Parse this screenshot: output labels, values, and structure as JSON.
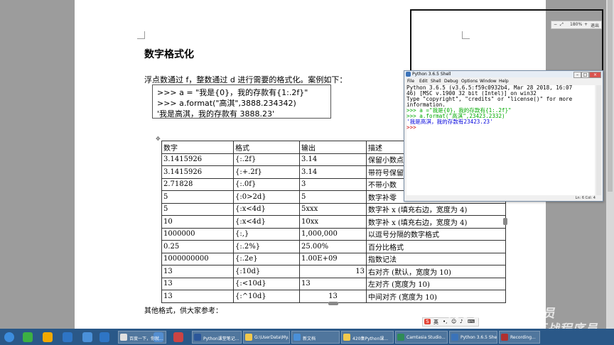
{
  "document": {
    "title": "数字格式化",
    "intro": "浮点数通过 f，整数通过 d 进行需要的格式化。案例如下：",
    "code_lines": [
      ">>> a = \"我是{0}，我的存款有{1:.2f}\"",
      ">>> a.format(\"高淇\",3888.234342)",
      "'我是高淇，我的存款有 3888.23'"
    ],
    "table": {
      "headers": [
        "数字",
        "格式",
        "输出",
        "描述"
      ],
      "rows": [
        [
          "3.1415926",
          "{:.2f}",
          "3.14",
          "保留小数点"
        ],
        [
          "3.1415926",
          "{:+.2f}",
          "3.14",
          "带符号保留"
        ],
        [
          "2.71828",
          "{:.0f}",
          "3",
          "不带小数"
        ],
        [
          "5",
          "{:0>2d}",
          "5",
          "数字补零"
        ],
        [
          "5",
          "{:x<4d}",
          "5xxx",
          "数字补 x (填充右边，宽度为 4)"
        ],
        [
          "10",
          "{:x<4d}",
          "10xx",
          "数字补 x (填充右边，宽度为 4)"
        ],
        [
          "1000000",
          "{:,}",
          "1,000,000",
          "以逗号分隔的数字格式"
        ],
        [
          "0.25",
          "{:.2%}",
          "25.00%",
          "百分比格式"
        ],
        [
          "1000000000",
          "{:.2e}",
          "1.00E+09",
          "指数记法"
        ],
        [
          "13",
          "{:10d}",
          "13",
          "右对齐 (默认，宽度为 10)"
        ],
        [
          "13",
          "{:<10d}",
          "13",
          "左对齐 (宽度为 10)"
        ],
        [
          "13",
          "{:^10d}",
          "13",
          "中间对齐 (宽度为 10)"
        ]
      ],
      "output_align": [
        "left",
        "left",
        "left",
        "left",
        "left",
        "left",
        "left",
        "left",
        "left",
        "right",
        "left",
        "center"
      ]
    },
    "footer": "其他格式，供大家参考："
  },
  "zoom": {
    "level": "180%",
    "exit_label": "退出"
  },
  "shell": {
    "title": "Python 3.6.5 Shell",
    "menu": [
      "File",
      "Edit",
      "Shell",
      "Debug",
      "Options",
      "Window",
      "Help"
    ],
    "lines": [
      {
        "text": "Python 3.6.5 (v3.6.5:f59c0932b4, Mar 28 2018, 16:07",
        "color": "#000000"
      },
      {
        "text": "46) [MSC v.1900 32 bit (Intel)] on win32",
        "color": "#000000"
      },
      {
        "text": "Type \"copyright\", \"credits\" or \"license()\" for more",
        "color": "#000000"
      },
      {
        "text": " information.",
        "color": "#000000"
      },
      {
        "text": ">>> a =\"我是{0}，我的存款有{1:.2f}\"",
        "color": "#00aa00"
      },
      {
        "text": ">>> a.format(\"高淇\",23423.2332)",
        "color": "#00aa00"
      },
      {
        "text": "'我是高淇，我的存款有23423.23'",
        "color": "#0000dd"
      },
      {
        "text": ">>> ",
        "color": "#cc0000"
      }
    ],
    "status": "Ln: 6  Col: 4"
  },
  "watermark": [
    "尚学堂·百战程序员",
    "尚学堂·百战程序员"
  ],
  "ime": {
    "label": "英"
  },
  "taskbar": {
    "buttons": [
      {
        "label": "百度一下，你就...",
        "color": "#e0e0e0"
      },
      {
        "label": "Python课堂笔记...",
        "color": "#2b579a"
      },
      {
        "label": "G:\\UserData\\My...",
        "color": "#f2c94c"
      },
      {
        "label": "新文档",
        "color": "#4a90d9"
      },
      {
        "label": "420集Python课...",
        "color": "#f2c94c"
      },
      {
        "label": "Camtasia Studio...",
        "color": "#2e8b57"
      },
      {
        "label": "Python 3.6.5 Shell",
        "color": "#3b73b9"
      },
      {
        "label": "Recording...",
        "color": "#b03030"
      }
    ],
    "pinned_colors": [
      "#3cb043",
      "#f2a900",
      "#2e75c5",
      "#4a90d9",
      "#2e75c5",
      "#2e75c5",
      "#cc4444"
    ]
  }
}
